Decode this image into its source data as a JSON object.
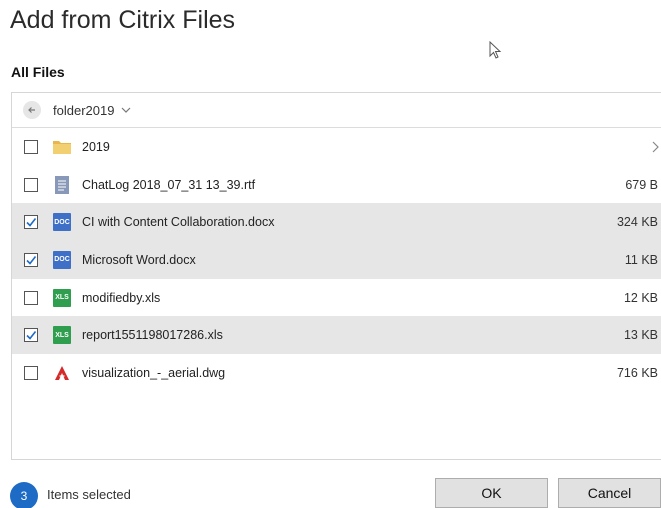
{
  "dialog": {
    "title": "Add from Citrix Files"
  },
  "section": {
    "title": "All Files"
  },
  "breadcrumb": {
    "folder": "folder2019"
  },
  "files": [
    {
      "name": "2019",
      "size": "",
      "type": "folder",
      "checked": false,
      "selected": false
    },
    {
      "name": "ChatLog  2018_07_31 13_39.rtf",
      "size": "679 B",
      "type": "rtf",
      "checked": false,
      "selected": false
    },
    {
      "name": "CI with Content Collaboration.docx",
      "size": "324 KB",
      "type": "doc",
      "checked": true,
      "selected": true
    },
    {
      "name": "Microsoft Word.docx",
      "size": "11 KB",
      "type": "doc",
      "checked": true,
      "selected": true
    },
    {
      "name": "modifiedby.xls",
      "size": "12 KB",
      "type": "xls",
      "checked": false,
      "selected": false
    },
    {
      "name": "report1551198017286.xls",
      "size": "13 KB",
      "type": "xls",
      "checked": true,
      "selected": true
    },
    {
      "name": "visualization_-_aerial.dwg",
      "size": "716 KB",
      "type": "dwg",
      "checked": false,
      "selected": false
    }
  ],
  "icons": {
    "doc_badge": "DOC",
    "xls_badge": "XLS"
  },
  "footer": {
    "count": "3",
    "label": "Items selected",
    "ok_label": "OK",
    "cancel_label": "Cancel"
  },
  "colors": {
    "accent": "#1e6bc6",
    "selected_row": "#e6e6e6",
    "doc": "#3f70c8",
    "xls": "#2f9e4f",
    "dwg": "#d42a2a",
    "folder": "#e8b64c"
  }
}
